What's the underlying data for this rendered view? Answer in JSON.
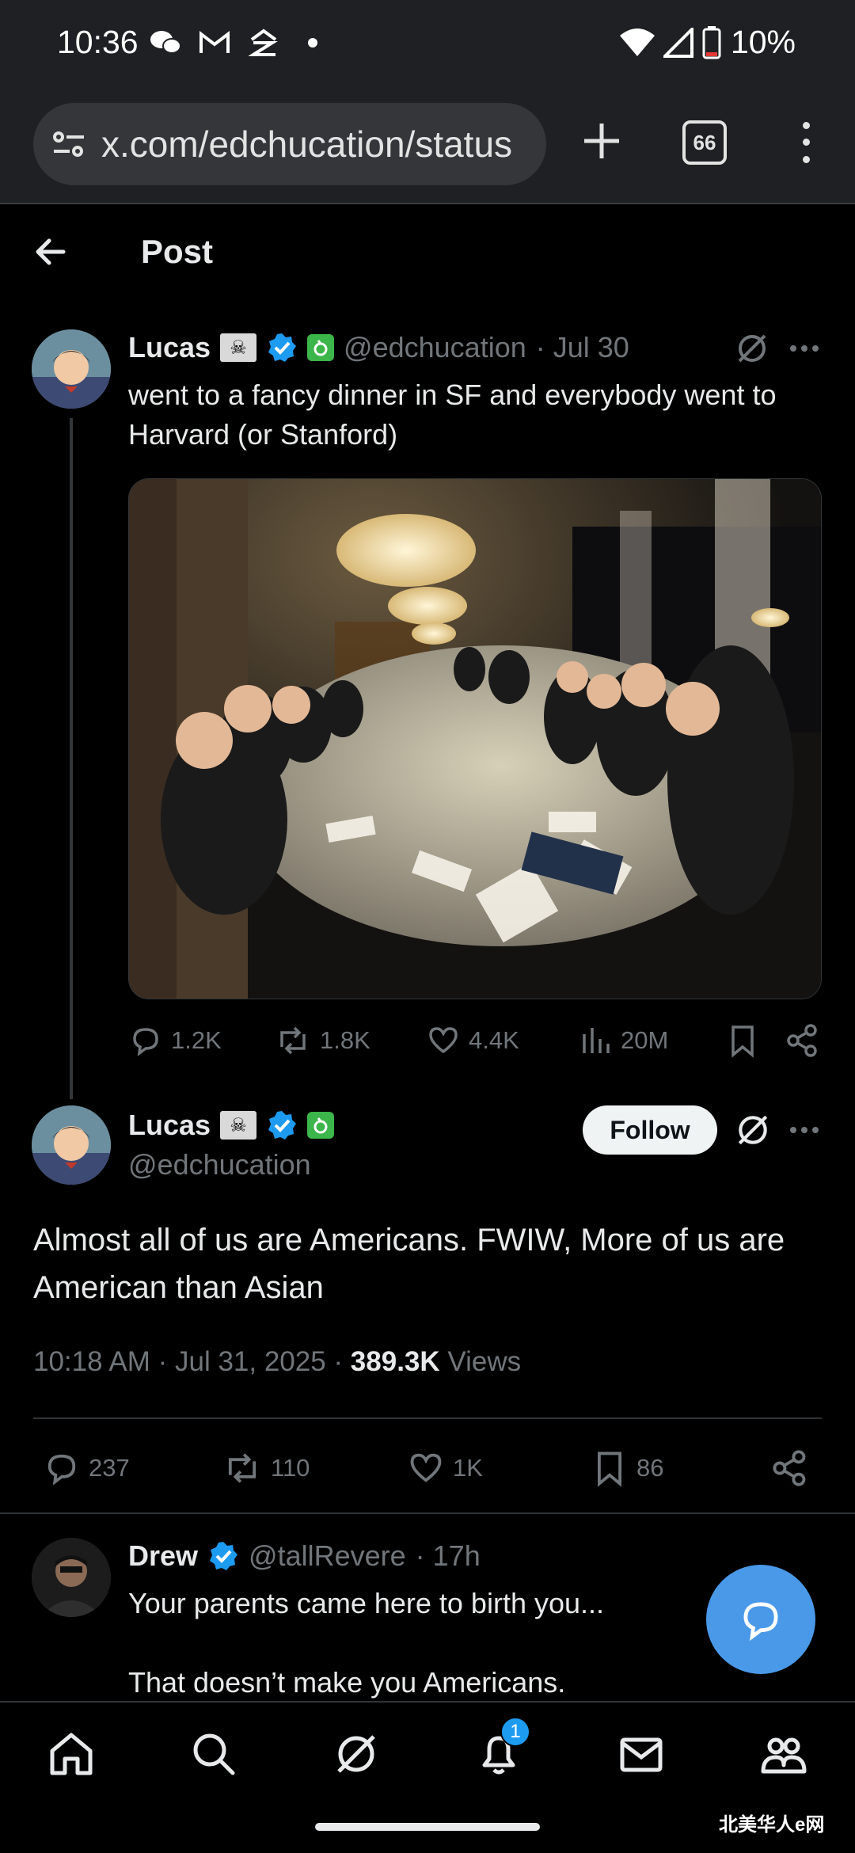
{
  "status_bar": {
    "time": "10:36",
    "battery": "10%",
    "icons": [
      "wechat-icon",
      "gmail-icon",
      "zillow-icon",
      "dot-icon",
      "wifi-icon",
      "signal-icon",
      "battery-icon"
    ]
  },
  "browser": {
    "url": "x.com/edchucation/status",
    "tab_count": "66"
  },
  "header": {
    "title": "Post"
  },
  "parent_post": {
    "name": "Lucas",
    "handle": "@edchucation",
    "date": "· Jul 30",
    "text": "went to a fancy dinner in SF and everybody went to Harvard (or Stanford)",
    "stats": {
      "replies": "1.2K",
      "reposts": "1.8K",
      "likes": "4.4K",
      "views": "20M"
    }
  },
  "main_post": {
    "name": "Lucas",
    "handle": "@edchucation",
    "follow_label": "Follow",
    "text": "Almost all of us are Americans. FWIW, More of us are American than Asian",
    "timestamp": "10:18 AM · Jul 31, 2025 · ",
    "views_count": "389.3K",
    "views_label": " Views",
    "stats": {
      "replies": "237",
      "reposts": "110",
      "likes": "1K",
      "bookmarks": "86"
    }
  },
  "reply": {
    "name": "Drew",
    "handle": "@tallRevere",
    "date": "· 17h",
    "line1": "Your parents came here to birth you...",
    "line2": "That doesn’t make you Americans."
  },
  "bottom_nav": {
    "notification_count": "1"
  },
  "watermark": "北美华人e网",
  "colors": {
    "accent": "#1d9bf0",
    "fab": "#4a99e9",
    "background": "#000000",
    "muted": "#71767b"
  }
}
